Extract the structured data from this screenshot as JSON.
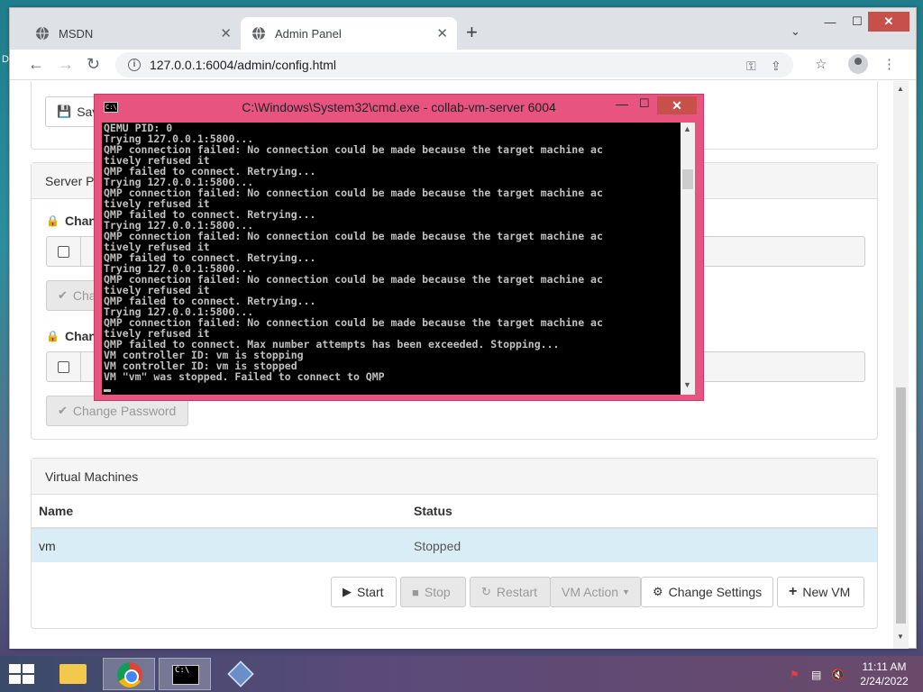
{
  "desktop": {
    "edge_letter": "D"
  },
  "browser": {
    "tabs": [
      {
        "label": "MSDN",
        "icon": "globe-icon",
        "active": false
      },
      {
        "label": "Admin Panel",
        "icon": "globe-icon",
        "active": true
      }
    ],
    "new_tab": "+",
    "tab_menu": "⌄",
    "window_controls": {
      "minimize": "—",
      "maximize": "☐",
      "close": "✕"
    },
    "nav": {
      "back": "←",
      "forward": "→",
      "reload": "↻"
    },
    "url": "127.0.0.1:6004/admin/config.html",
    "toolbar_icons": {
      "key": "⚿",
      "share": "⇪",
      "bookmark": "☆",
      "menu": "⋮"
    }
  },
  "page": {
    "save_button": "Sav",
    "server_panel_title": "Server P",
    "change_label_1": "Chang",
    "change_label_2": "Chang",
    "change_button_partial": "Cha",
    "change_password_button": "Change Password",
    "vm_panel": {
      "title": "Virtual Machines",
      "columns": [
        "Name",
        "Status"
      ],
      "rows": [
        {
          "name": "vm",
          "status": "Stopped"
        }
      ],
      "buttons": {
        "start": "Start",
        "stop": "Stop",
        "restart": "Restart",
        "vm_action": "VM Action",
        "change_settings": "Change Settings",
        "new_vm": "New VM"
      }
    }
  },
  "cmd": {
    "title": "C:\\Windows\\System32\\cmd.exe - collab-vm-server  6004",
    "icon_text": "C:\\",
    "controls": {
      "minimize": "—",
      "maximize": "☐",
      "close": "✕"
    },
    "lines": [
      "QEMU PID: 0",
      "Trying 127.0.0.1:5800...",
      "QMP connection failed: No connection could be made because the target machine ac",
      "tively refused it",
      "QMP failed to connect. Retrying...",
      "Trying 127.0.0.1:5800...",
      "QMP connection failed: No connection could be made because the target machine ac",
      "tively refused it",
      "QMP failed to connect. Retrying...",
      "Trying 127.0.0.1:5800...",
      "QMP connection failed: No connection could be made because the target machine ac",
      "tively refused it",
      "QMP failed to connect. Retrying...",
      "Trying 127.0.0.1:5800...",
      "QMP connection failed: No connection could be made because the target machine ac",
      "tively refused it",
      "QMP failed to connect. Retrying...",
      "Trying 127.0.0.1:5800...",
      "QMP connection failed: No connection could be made because the target machine ac",
      "tively refused it",
      "QMP failed to connect. Max number attempts has been exceeded. Stopping...",
      "VM controller ID: vm is stopping",
      "VM controller ID: vm is stopped",
      "VM \"vm\" was stopped. Failed to connect to QMP"
    ]
  },
  "taskbar": {
    "apps": [
      "file-explorer-icon",
      "chrome-icon",
      "cmd-icon",
      "virtualbox-icon"
    ],
    "tray": {
      "flag": "⚑",
      "network": "▤",
      "volume": "🔇"
    },
    "clock": {
      "time": "11:11 AM",
      "date": "2/24/2022"
    }
  }
}
